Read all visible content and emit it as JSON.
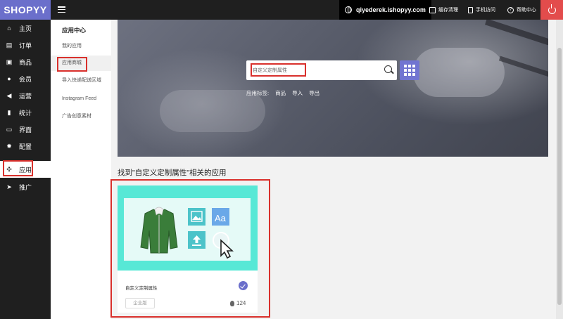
{
  "brand": {
    "logo": "SHOPYY"
  },
  "topbar": {
    "store": "qiyederek.ishopyy.com",
    "clear_cache": "缓存清理",
    "mobile_access": "手机访问",
    "help_center": "帮助中心"
  },
  "sidebar": {
    "items": [
      {
        "label": "主页",
        "icon": "home-icon"
      },
      {
        "label": "订单",
        "icon": "order-icon"
      },
      {
        "label": "商品",
        "icon": "product-icon"
      },
      {
        "label": "会员",
        "icon": "member-icon"
      },
      {
        "label": "运营",
        "icon": "megaphone-icon"
      },
      {
        "label": "统计",
        "icon": "chart-icon"
      },
      {
        "label": "界面",
        "icon": "layout-icon"
      },
      {
        "label": "配置",
        "icon": "gear-icon"
      },
      {
        "label": "应用",
        "icon": "apps-icon",
        "active": true
      },
      {
        "label": "推广",
        "icon": "send-icon"
      }
    ]
  },
  "subnav": {
    "title": "应用中心",
    "items": [
      {
        "label": "我的应用"
      },
      {
        "label": "应用商城",
        "active": true
      },
      {
        "label": "导入快递配送区域"
      },
      {
        "label": "Instagram Feed"
      },
      {
        "label": "广告创意素材"
      }
    ]
  },
  "search": {
    "value": "自定义定制属性",
    "tags_label": "应用标签:",
    "tags": [
      "商品",
      "导入",
      "导出"
    ]
  },
  "results": {
    "title": "找到\"自定义定制属性\"相关的应用",
    "cards": [
      {
        "name": "自定义定制属性",
        "badge": "企业版",
        "likes": "124"
      }
    ]
  },
  "colors": {
    "accent": "#6b6fcb",
    "highlight": "#d9302c",
    "card_bg": "#57e8d6"
  }
}
